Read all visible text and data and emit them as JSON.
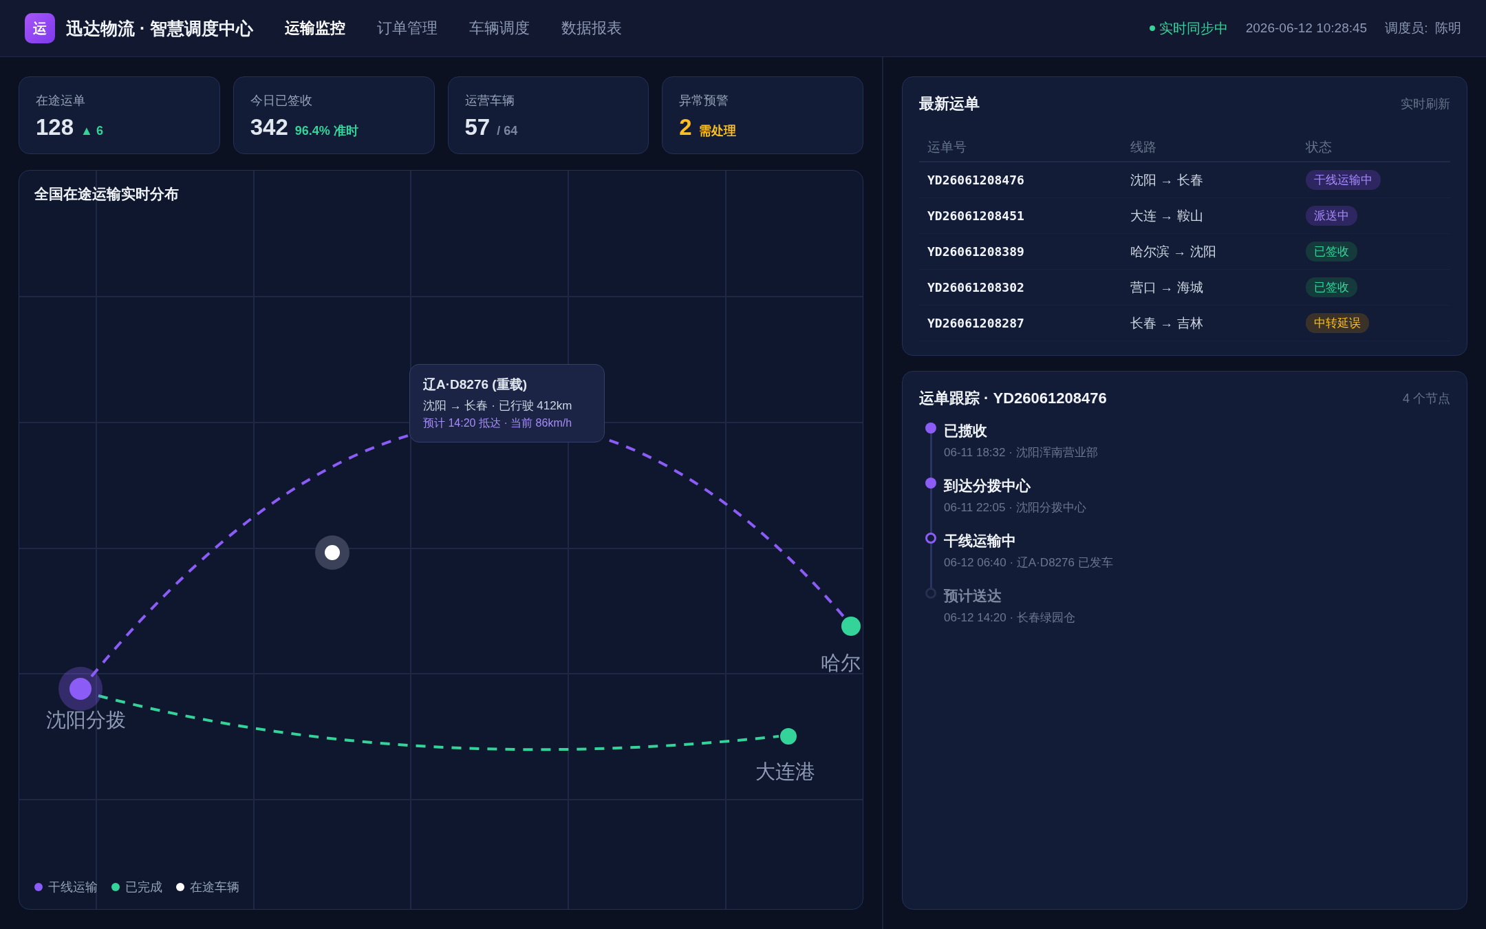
{
  "header": {
    "logo": "运",
    "brand": "迅达物流 · 智慧调度中心",
    "nav": [
      {
        "label": "运输监控",
        "selected": true
      },
      {
        "label": "订单管理",
        "selected": false
      },
      {
        "label": "车辆调度",
        "selected": false
      },
      {
        "label": "数据报表",
        "selected": false
      }
    ],
    "sync_status": "实时同步中",
    "datetime": "2026-06-12 10:28:45",
    "dispatcher": "调度员:  陈明"
  },
  "kpis": [
    {
      "label": "在途运单",
      "value": "128",
      "note": "▲ 6",
      "kind": "up"
    },
    {
      "label": "今日已签收",
      "value": "342",
      "note": "96.4% 准时",
      "kind": "good"
    },
    {
      "label": "运营车辆",
      "value": "57",
      "note": "/ 64",
      "kind": "neutral"
    },
    {
      "label": "异常预警",
      "value": "2",
      "note": "需处理",
      "kind": "alert"
    }
  ],
  "map": {
    "title": "全国在途运输实时分布",
    "cities": [
      {
        "name": "沈阳分拨",
        "kind": "hub"
      },
      {
        "name": "哈尔",
        "kind": "active"
      },
      {
        "name": "大连港",
        "kind": "done"
      }
    ],
    "tooltip": {
      "title": "辽A·D8276 (重载)",
      "line": "沈阳 → 长春 · 已行驶 412km",
      "eta": "预计 14:20 抵达 · 当前 86km/h"
    },
    "legend": [
      {
        "label": "干线运输",
        "color": "#8b5cf6"
      },
      {
        "label": "已完成",
        "color": "#34d399"
      },
      {
        "label": "在途车辆",
        "color": "#ffffff"
      }
    ]
  },
  "orders": {
    "title": "最新运单",
    "action": "实时刷新",
    "columns": [
      "运单号",
      "线路",
      "状态"
    ],
    "rows": [
      {
        "id": "YD26061208476",
        "route": "沈阳 → 长春",
        "status": "干线运输中",
        "kind": "transit"
      },
      {
        "id": "YD26061208451",
        "route": "大连 → 鞍山",
        "status": "派送中",
        "kind": "transit"
      },
      {
        "id": "YD26061208389",
        "route": "哈尔滨 → 沈阳",
        "status": "已签收",
        "kind": "signed"
      },
      {
        "id": "YD26061208302",
        "route": "营口 → 海城",
        "status": "已签收",
        "kind": "signed"
      },
      {
        "id": "YD26061208287",
        "route": "长春 → 吉林",
        "status": "中转延误",
        "kind": "delayed"
      }
    ]
  },
  "tracking": {
    "title": "运单跟踪 · YD26061208476",
    "count": "4 个节点",
    "steps": [
      {
        "title": "已揽收",
        "detail": "06-11 18:32 · 沈阳浑南营业部",
        "done": true,
        "current": false
      },
      {
        "title": "到达分拨中心",
        "detail": "06-11 22:05 · 沈阳分拨中心",
        "done": true,
        "current": false
      },
      {
        "title": "干线运输中",
        "detail": "06-12 06:40 · 辽A·D8276 已发车",
        "done": false,
        "current": true
      },
      {
        "title": "预计送达",
        "detail": "06-12 14:20 · 长春绿园仓",
        "done": false,
        "current": false
      }
    ]
  }
}
